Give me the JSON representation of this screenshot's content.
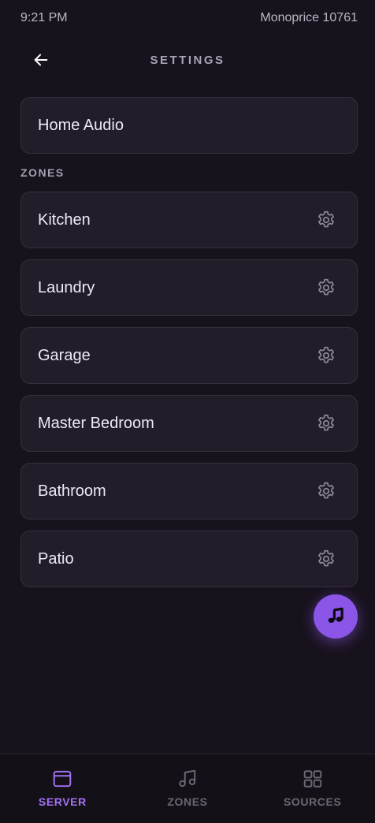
{
  "status_bar": {
    "time": "9:21 PM",
    "device": "Monoprice 10761"
  },
  "header": {
    "back_icon": "arrow-left-icon",
    "title": "SETTINGS"
  },
  "server_card": {
    "label": "Home Audio"
  },
  "zones_section": {
    "label": "ZONES",
    "items": [
      {
        "label": "Kitchen",
        "icon": "gear-icon"
      },
      {
        "label": "Laundry",
        "icon": "gear-icon"
      },
      {
        "label": "Garage",
        "icon": "gear-icon"
      },
      {
        "label": "Master Bedroom",
        "icon": "gear-icon"
      },
      {
        "label": "Bathroom",
        "icon": "gear-icon"
      },
      {
        "label": "Patio",
        "icon": "gear-icon"
      }
    ]
  },
  "fab": {
    "icon": "music-note-icon"
  },
  "bottom_nav": {
    "items": [
      {
        "label": "SERVER",
        "icon": "browser-window-icon",
        "active": true
      },
      {
        "label": "ZONES",
        "icon": "music-notes-icon",
        "active": false
      },
      {
        "label": "SOURCES",
        "icon": "grid-icon",
        "active": false
      }
    ]
  },
  "colors": {
    "background": "#17121c",
    "card": "#221d29",
    "accent": "#8b55e8",
    "nav_active": "#a472f5",
    "nav_inactive": "#6c6675"
  }
}
